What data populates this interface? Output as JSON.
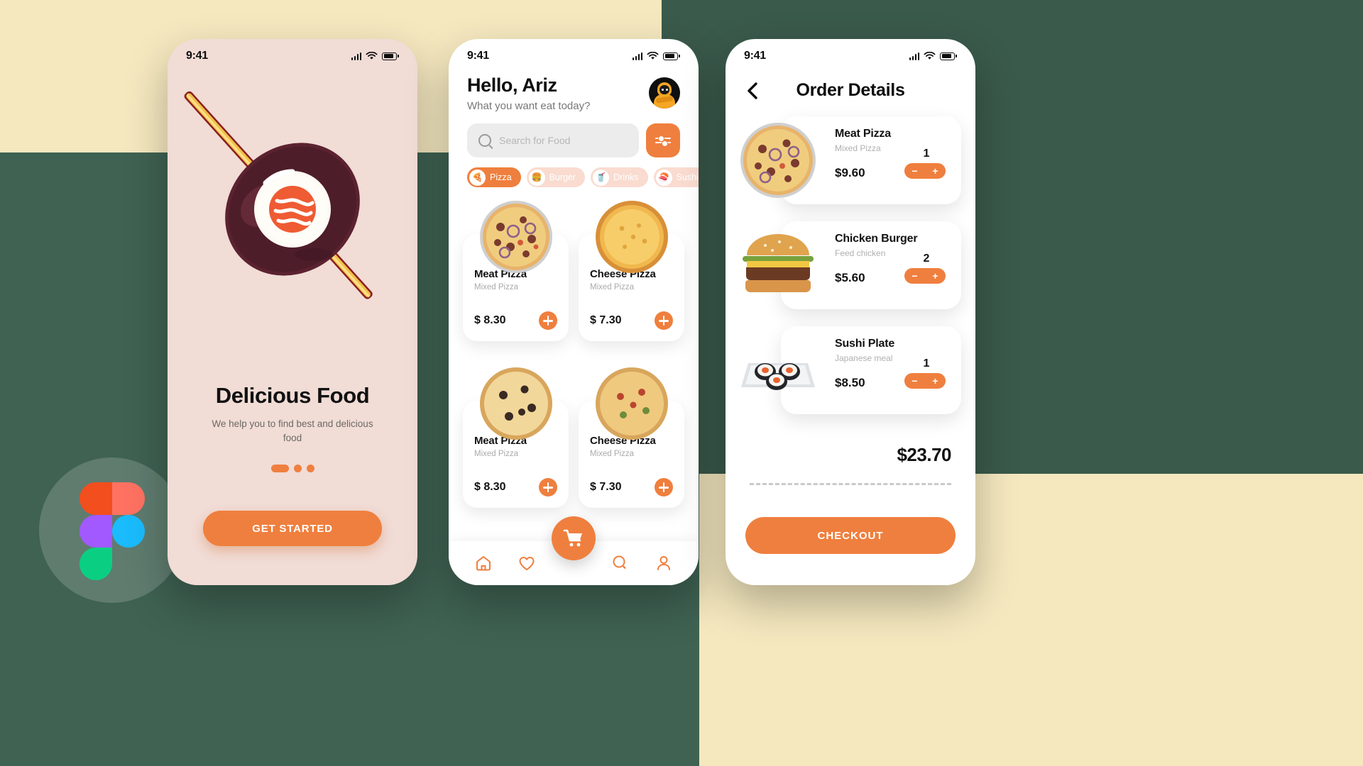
{
  "brand": {
    "accent": "#ef7f3e",
    "accent_soft": "#fadbd0",
    "bg_cream": "#f5e8bf",
    "bg_green": "#3f6252",
    "badge": "figma-logo"
  },
  "status_bar": {
    "time": "9:41",
    "icons": [
      "signal-icon",
      "wifi-icon",
      "battery-icon"
    ]
  },
  "screen1": {
    "illustration": "sushi-roll-chopsticks-illustration",
    "title": "Delicious Food",
    "subtitle": "We help you to find best and delicious food",
    "pagination": {
      "count": 3,
      "active_index": 0
    },
    "cta_label": "GET STARTED"
  },
  "screen2": {
    "greeting": "Hello,  Ariz",
    "question": "What you want eat today?",
    "avatar": "user-avatar",
    "search": {
      "placeholder": "Search for Food",
      "value": ""
    },
    "filter_button": "filter-icon",
    "categories": [
      {
        "label": "Pizza",
        "icon": "🍕",
        "active": true
      },
      {
        "label": "Burger",
        "icon": "🍔",
        "active": false
      },
      {
        "label": "Drinks",
        "icon": "🥤",
        "active": false
      },
      {
        "label": "Sushi",
        "icon": "🍣",
        "active": false
      }
    ],
    "foods": [
      {
        "name": "Meat Pizza",
        "desc": "Mixed Pizza",
        "price": "$ 8.30",
        "image": "meat-pizza-photo"
      },
      {
        "name": "Cheese Pizza",
        "desc": "Mixed Pizza",
        "price": "$ 7.30",
        "image": "cheese-pizza-photo"
      },
      {
        "name": "Meat Pizza",
        "desc": "Mixed Pizza",
        "price": "$ 8.30",
        "image": "mushroom-pizza-photo"
      },
      {
        "name": "Cheese Pizza",
        "desc": "Mixed Pizza",
        "price": "$ 7.30",
        "image": "veggie-pizza-photo"
      }
    ],
    "tabs": [
      {
        "name": "home-icon"
      },
      {
        "name": "heart-icon"
      },
      {
        "name": "cart-icon"
      },
      {
        "name": "chat-icon"
      },
      {
        "name": "profile-icon"
      }
    ]
  },
  "screen3": {
    "back": "chevron-left-icon",
    "title": "Order Details",
    "items": [
      {
        "name": "Meat Pizza",
        "desc": "Mixed Pizza",
        "price": "$9.60",
        "qty": "1",
        "image": "meat-pizza-photo"
      },
      {
        "name": "Chicken Burger",
        "desc": "Feed chicken",
        "price": "$5.60",
        "qty": "2",
        "image": "chicken-burger-photo"
      },
      {
        "name": "Sushi Plate",
        "desc": "Japanese meal",
        "price": "$8.50",
        "qty": "1",
        "image": "sushi-plate-photo"
      }
    ],
    "total": "$23.70",
    "checkout_label": "CHECKOUT",
    "minus": "−",
    "plus": "+"
  }
}
